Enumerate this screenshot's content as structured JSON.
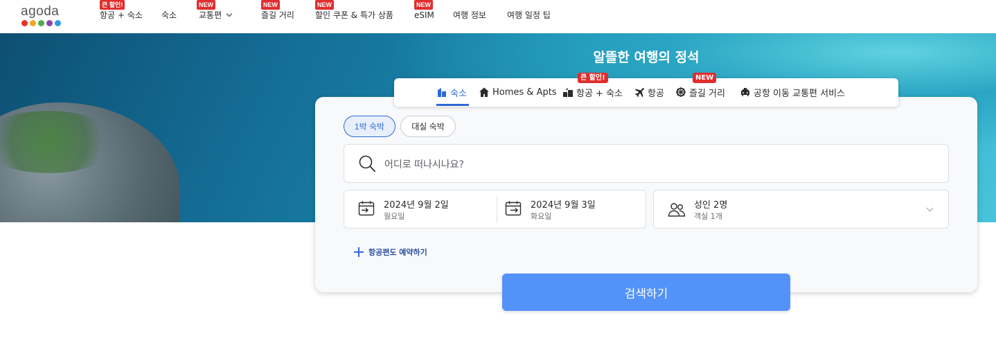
{
  "brand": {
    "logo_text": "agoda",
    "dot_colors": [
      "#e4312b",
      "#f5a623",
      "#4cae4f",
      "#8e44ad",
      "#2d9be4"
    ]
  },
  "nav": {
    "items": [
      {
        "label": "항공 + 숙소",
        "badge": "큰 할인!"
      },
      {
        "label": "숙소",
        "badge": ""
      },
      {
        "label": "교통편",
        "badge": "NEW"
      },
      {
        "label": "즐길 거리",
        "badge": "NEW"
      },
      {
        "label": "할인 쿠폰 & 특가 상품",
        "badge": "NEW"
      },
      {
        "label": "eSIM",
        "badge": "NEW"
      },
      {
        "label": "여행 정보",
        "badge": ""
      },
      {
        "label": "여행 일정 팁",
        "badge": ""
      }
    ]
  },
  "hero": {
    "title": "알뜰한 여행의 정석"
  },
  "tabs": [
    {
      "label": "숙소",
      "icon": "hotel-icon",
      "active": true,
      "badge": ""
    },
    {
      "label": "Homes & Apts",
      "icon": "home-icon",
      "active": false,
      "badge": ""
    },
    {
      "label": "항공 + 숙소",
      "icon": "flight-hotel-icon",
      "active": false,
      "badge": "큰 할인!"
    },
    {
      "label": "항공",
      "icon": "airplane-icon",
      "active": false,
      "badge": ""
    },
    {
      "label": "즐길 거리",
      "icon": "activity-icon",
      "active": false,
      "badge": "NEW"
    },
    {
      "label": "공항 이동 교통편 서비스",
      "icon": "car-icon",
      "active": false,
      "badge": ""
    }
  ],
  "stay_type": {
    "options": [
      "1박 숙박",
      "대실 숙박"
    ],
    "selected": "1박 숙박"
  },
  "search": {
    "placeholder": "어디로 떠나시나요?"
  },
  "dates": {
    "checkin": {
      "date": "2024년 9월 2일",
      "weekday": "월요일"
    },
    "checkout": {
      "date": "2024년 9월 3일",
      "weekday": "화요일"
    }
  },
  "guests": {
    "summary": "성인 2명",
    "rooms": "객실 1개"
  },
  "add_flight_label": "항공편도 예약하기",
  "search_button_label": "검색하기",
  "colors": {
    "accent": "#2f68d8",
    "button": "#5392f9",
    "badge": "#e12d2d"
  }
}
